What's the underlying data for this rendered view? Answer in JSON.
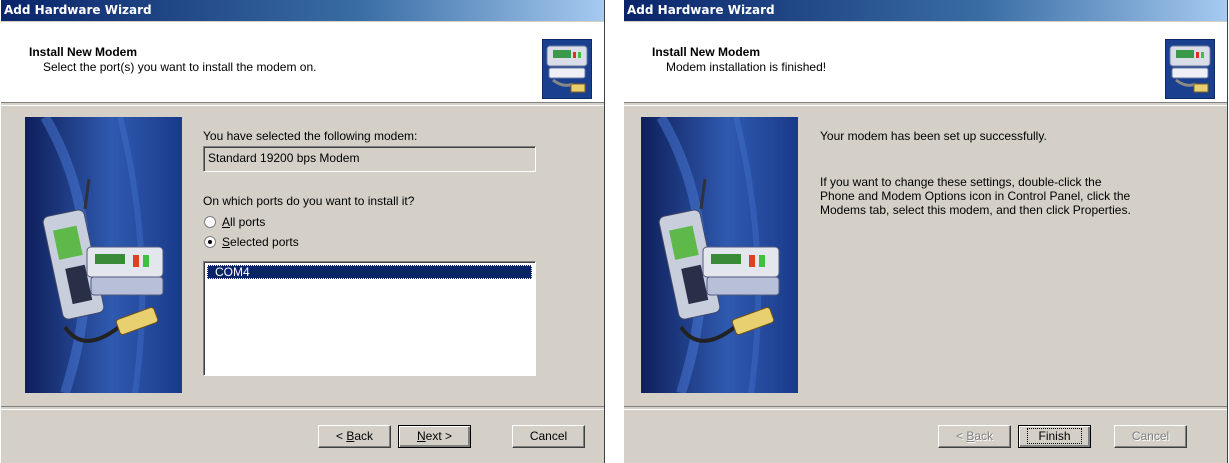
{
  "left_window": {
    "title": "Add Hardware Wizard",
    "header_title": "Install New Modem",
    "header_subtitle": "Select the port(s) you want to install the modem on.",
    "selected_modem_label": "You have selected the following modem:",
    "selected_modem_value": "Standard 19200 bps Modem",
    "ports_question": "On which ports do you want to install it?",
    "radio_all_ports": {
      "prefix": "",
      "accel": "A",
      "rest": "ll ports",
      "checked": false
    },
    "radio_selected_ports": {
      "prefix": "",
      "accel": "S",
      "rest": "elected ports",
      "checked": true
    },
    "ports_list": [
      "COM4"
    ],
    "buttons": {
      "back": {
        "prefix": "< ",
        "accel": "B",
        "rest": "ack"
      },
      "next": {
        "prefix": "",
        "accel": "N",
        "rest": "ext >"
      },
      "cancel": "Cancel"
    }
  },
  "right_window": {
    "title": "Add Hardware Wizard",
    "header_title": "Install New Modem",
    "header_subtitle": "Modem installation is finished!",
    "success_text": "Your modem has been set up successfully.",
    "info_line1": "If you want to change these settings, double-click the",
    "info_line2": "Phone and Modem Options icon in Control Panel, click the",
    "info_line3": "Modems tab, select this modem, and then click Properties.",
    "buttons": {
      "back": {
        "prefix": "< ",
        "accel": "B",
        "rest": "ack"
      },
      "finish": "Finish",
      "cancel": "Cancel"
    }
  },
  "icons": {
    "header_icon": "modem-hardware-icon",
    "side_image": "modem-phone-illustration"
  }
}
